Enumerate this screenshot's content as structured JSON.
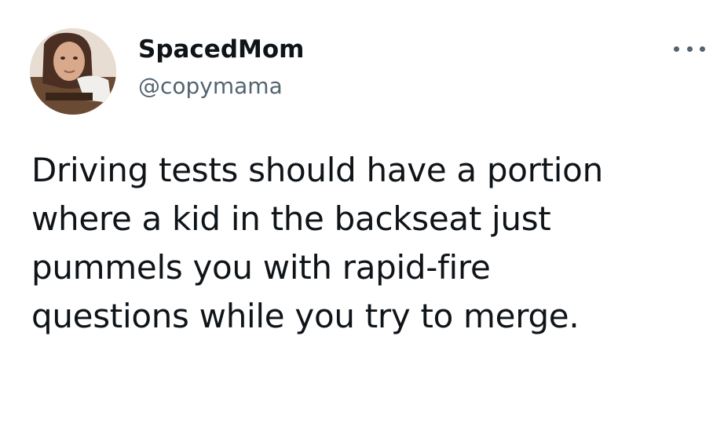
{
  "author": {
    "display_name": "SpacedMom",
    "handle": "@copymama",
    "avatar_icon": "profile-photo"
  },
  "more_menu": {
    "icon": "more-horizontal-icon"
  },
  "tweet": {
    "lines": [
      "Driving tests should have a portion",
      "where a kid in the backseat just",
      "pummels you with rapid-fire",
      "questions while you try to merge."
    ]
  },
  "colors": {
    "text_primary": "#0f1419",
    "text_secondary": "#536471",
    "background": "#ffffff"
  }
}
